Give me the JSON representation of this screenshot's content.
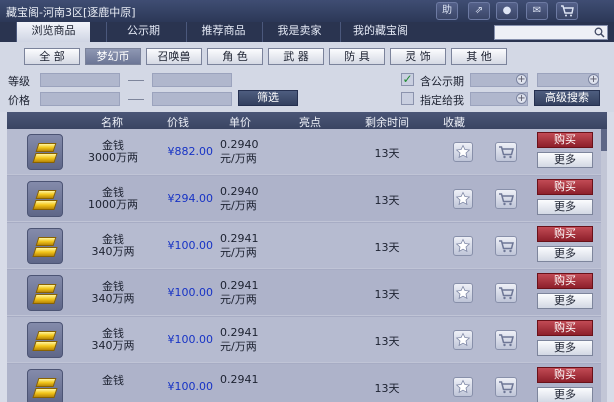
{
  "window": {
    "title": "藏宝阁-河南3区[逐鹿中原]",
    "buttons": [
      {
        "name": "help-button",
        "label": "助"
      },
      {
        "name": "share-button",
        "label": "⇗"
      },
      {
        "name": "record-button",
        "label": "●"
      },
      {
        "name": "chat-button",
        "label": "✉"
      },
      {
        "name": "cart-button",
        "label": "🛒"
      }
    ]
  },
  "nav": {
    "tabs": [
      "浏览商品",
      "公示期",
      "推荐商品",
      "我是卖家",
      "我的藏宝阁"
    ],
    "active": 0
  },
  "categories": {
    "items": [
      "全 部",
      "梦幻币",
      "召唤兽",
      "角 色",
      "武 器",
      "防 具",
      "灵 饰",
      "其 他"
    ],
    "active": 1
  },
  "filters": {
    "level_label": "等级",
    "price_label": "价格",
    "filter_button": "筛选",
    "include_public_label": "含公示期",
    "include_public_checked": true,
    "assign_to_me_label": "指定给我",
    "assign_to_me_checked": false,
    "advanced_search_button": "高级搜索"
  },
  "table": {
    "headers": [
      "名称",
      "价钱",
      "单价",
      "亮点",
      "剩余时间",
      "收藏"
    ],
    "rows": [
      {
        "name": "金钱",
        "amount": "3000万两",
        "price": "¥882.00",
        "unit_a": "0.2940",
        "unit_b": "元/万两",
        "remain": "13天"
      },
      {
        "name": "金钱",
        "amount": "1000万两",
        "price": "¥294.00",
        "unit_a": "0.2940",
        "unit_b": "元/万两",
        "remain": "13天"
      },
      {
        "name": "金钱",
        "amount": "340万两",
        "price": "¥100.00",
        "unit_a": "0.2941",
        "unit_b": "元/万两",
        "remain": "13天"
      },
      {
        "name": "金钱",
        "amount": "340万两",
        "price": "¥100.00",
        "unit_a": "0.2941",
        "unit_b": "元/万两",
        "remain": "13天"
      },
      {
        "name": "金钱",
        "amount": "340万两",
        "price": "¥100.00",
        "unit_a": "0.2941",
        "unit_b": "元/万两",
        "remain": "13天"
      },
      {
        "name": "金钱",
        "amount": "",
        "price": "¥100.00",
        "unit_a": "0.2941",
        "unit_b": "",
        "remain": "13天"
      }
    ],
    "buy_label": "购买",
    "more_label": "更多"
  },
  "colors": {
    "accent": "#2c3857",
    "price_blue": "#1733c5",
    "buy_red": "#a8323c"
  }
}
